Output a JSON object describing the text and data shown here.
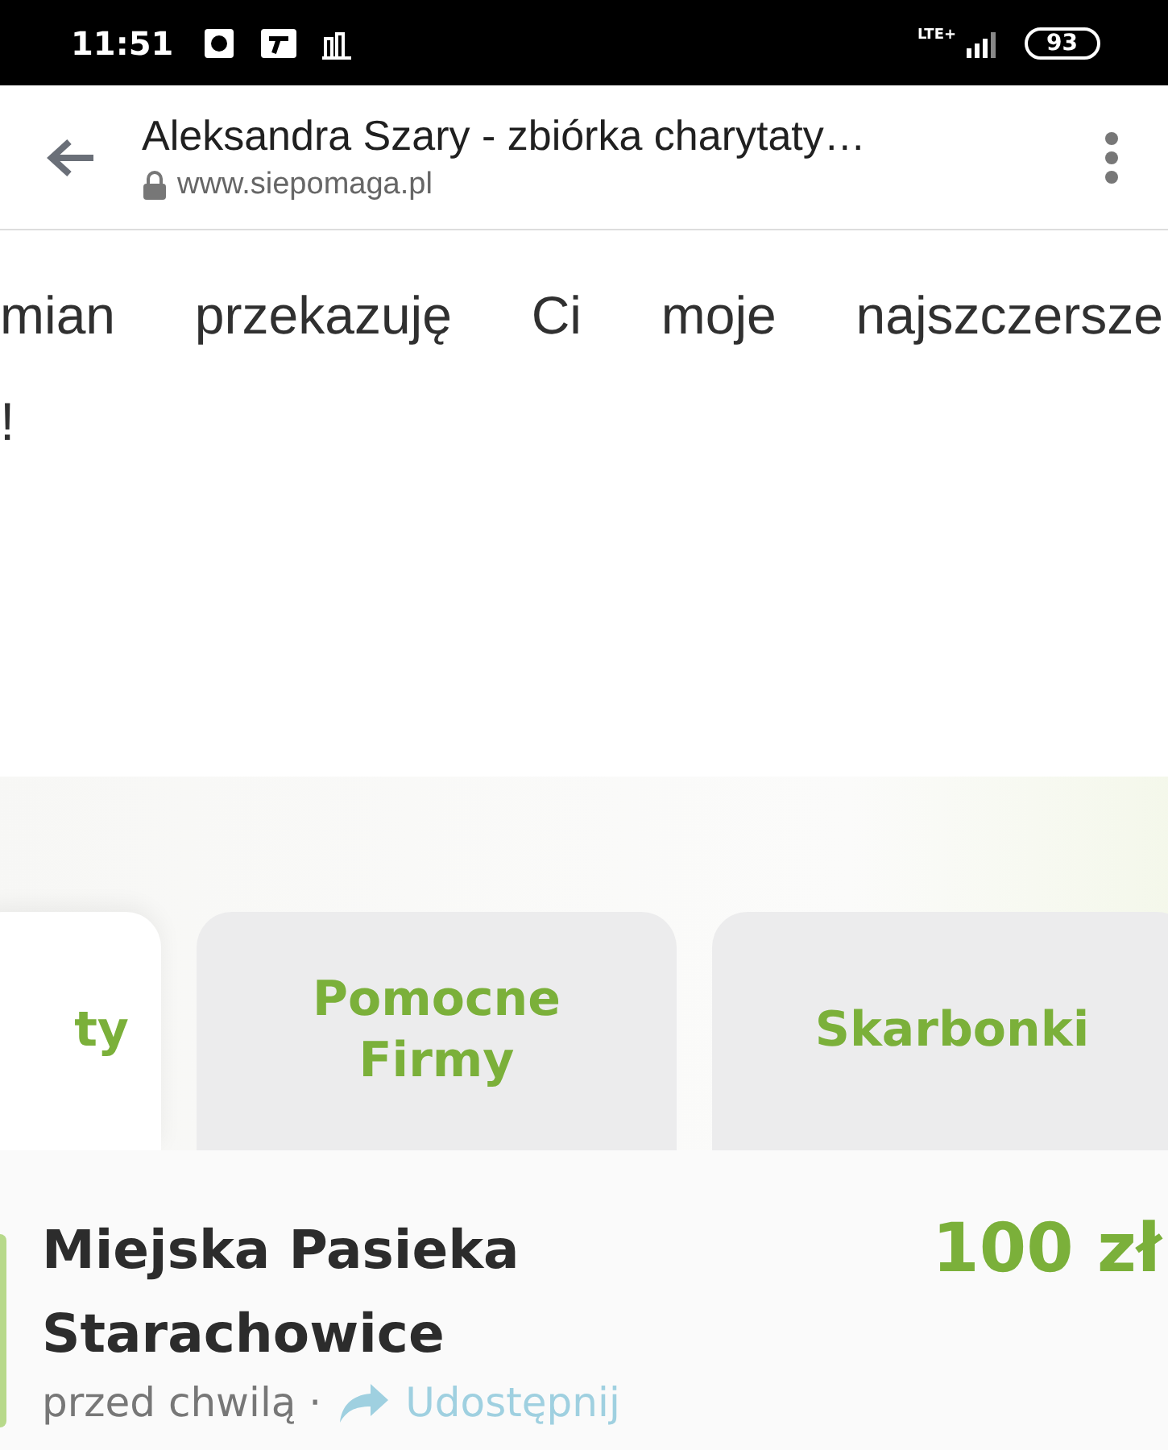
{
  "status_bar": {
    "time": "11:51",
    "network": "LTE+",
    "battery": "93"
  },
  "toolbar": {
    "title": "Aleksandra Szary - zbiórka charytaty…",
    "url": "www.siepomaga.pl"
  },
  "body_lines": [
    "mian przekazuję Ci moje najszczersze",
    "!"
  ],
  "tabs": [
    {
      "label": "ty",
      "selected": true
    },
    {
      "label": "Pomocne Firmy",
      "selected": false
    },
    {
      "label": "Skarbonki",
      "selected": false
    }
  ],
  "donation": {
    "name": "Miejska Pasieka Starachowice",
    "amount": "100 zł",
    "time": "przed chwilą ·",
    "share": "Udostępnij"
  }
}
